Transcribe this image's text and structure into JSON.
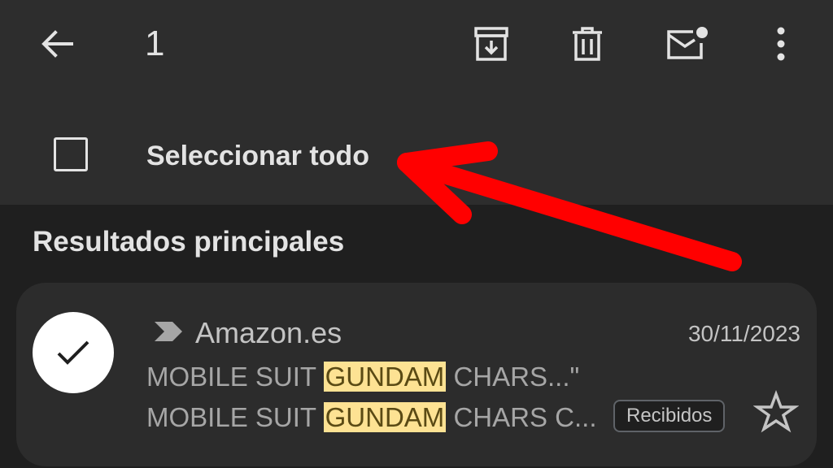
{
  "toolbar": {
    "selected_count": "1",
    "icons": {
      "back": "arrow-back-icon",
      "archive": "archive-icon",
      "delete": "trash-icon",
      "mark_unread": "mark-unread-icon",
      "more": "more-vert-icon"
    }
  },
  "select_all": {
    "label": "Seleccionar todo"
  },
  "results": {
    "heading": "Resultados principales",
    "emails": [
      {
        "sender": "Amazon.es",
        "date": "30/11/2023",
        "subject_prefix": "MOBILE SUIT ",
        "subject_match": "GUNDAM",
        "subject_suffix": " CHARS...\"",
        "snippet_prefix": "MOBILE SUIT ",
        "snippet_match": "GUNDAM",
        "snippet_suffix": " CHARS C...",
        "label": "Recibidos",
        "selected": true,
        "starred": false
      }
    ]
  },
  "colors": {
    "toolbar_bg": "#2d2d2d",
    "page_bg": "#1f1f1f",
    "card_bg": "#2c2c2c",
    "highlight": "#fde293",
    "annotation": "#ff0000"
  }
}
